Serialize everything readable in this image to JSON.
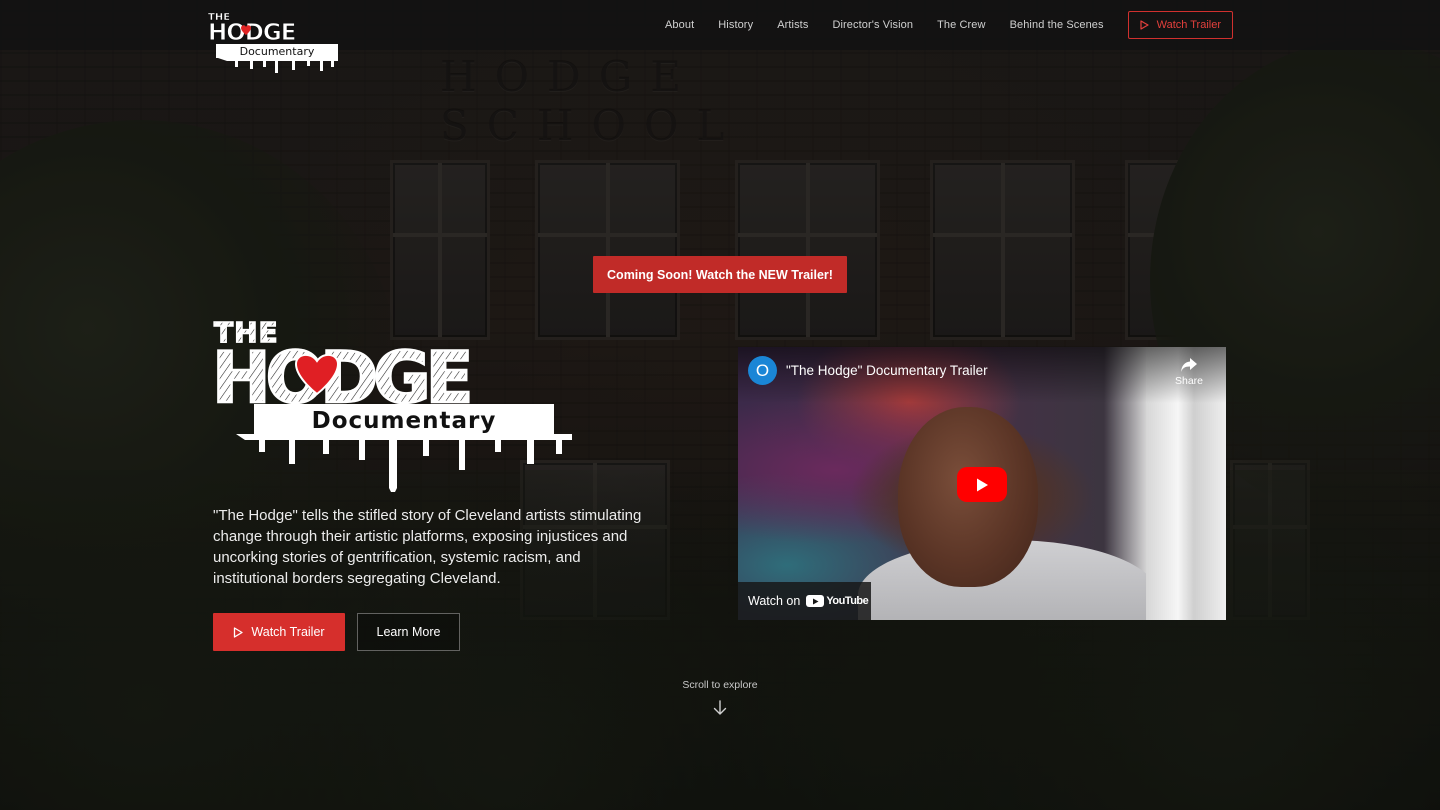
{
  "brand": {
    "logo_line1": "THE",
    "logo_line2": "HODGE",
    "logo_line3": "Documentary",
    "accent_color": "#d62f2c"
  },
  "nav": {
    "items": [
      {
        "label": "About"
      },
      {
        "label": "History"
      },
      {
        "label": "Artists"
      },
      {
        "label": "Director's Vision"
      },
      {
        "label": "The Crew"
      },
      {
        "label": "Behind the Scenes"
      }
    ],
    "cta_label": "Watch Trailer",
    "cta_icon": "play-outline-icon"
  },
  "background": {
    "engraving": "HODGE SCHOOL"
  },
  "announcement": {
    "label": "Coming Soon! Watch the NEW Trailer!"
  },
  "hero": {
    "description": "\"The Hodge\" tells the stifled story of Cleveland artists stimulating change through their artistic platforms, exposing injustices and uncorking stories of gentrification, systemic racism, and institutional borders segregating Cleveland.",
    "primary_label": "Watch Trailer",
    "secondary_label": "Learn More"
  },
  "video": {
    "channel_initial": "O",
    "title": "\"The Hodge\" Documentary Trailer",
    "share_label": "Share",
    "watch_on_label": "Watch on",
    "platform_label": "YouTube",
    "play_icon": "youtube-play-icon"
  },
  "scroll": {
    "label": "Scroll to explore",
    "icon": "arrow-down-icon"
  }
}
